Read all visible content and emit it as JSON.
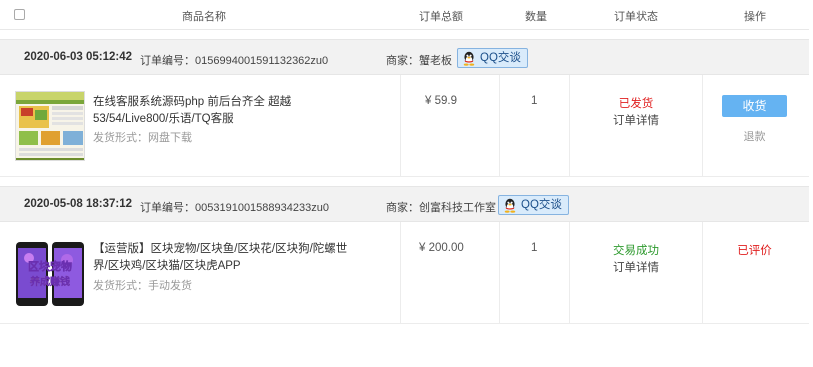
{
  "header": {
    "product_name": "商品名称",
    "order_total": "订单总额",
    "quantity": "数量",
    "order_status": "订单状态",
    "actions": "操作"
  },
  "orders": [
    {
      "date": "2020-06-03 05:12:42",
      "order_no": "订单编号：0156994001591132362zu0",
      "seller": "商家：蟹老板",
      "qq_label": "QQ交谈",
      "product": "在线客服系统源码php 前后台齐全 超越53/54/Live800/乐语/TQ客服",
      "ship": "发货形式：网盘下载",
      "price": "¥ 59.9",
      "qty": "1",
      "status": "已发货",
      "status_color": "#e02020",
      "detail": "订单详情",
      "action": "收货",
      "secondary_action": "退款"
    },
    {
      "date": "2020-05-08 18:37:12",
      "order_no": "订单编号：0053191001588934233zu0",
      "seller": "商家：创富科技工作室",
      "qq_label": "QQ交谈",
      "product": "【运营版】区块宠物/区块鱼/区块花/区块狗/陀螺世界/区块鸡/区块猫/区块虎APP",
      "ship": "发货形式：手动发货",
      "price": "¥ 200.00",
      "qty": "1",
      "status": "交易成功",
      "status_color": "#2e9a2e",
      "detail": "订单详情",
      "action": "已评价"
    }
  ],
  "thumb_text": {
    "line1": "区块宠物",
    "line2": "养成赚钱"
  },
  "colors": {
    "accent_button": "#65b3f2",
    "header_bg": "#f2f2f2",
    "qq_button_bg": "#d9ebfb"
  }
}
